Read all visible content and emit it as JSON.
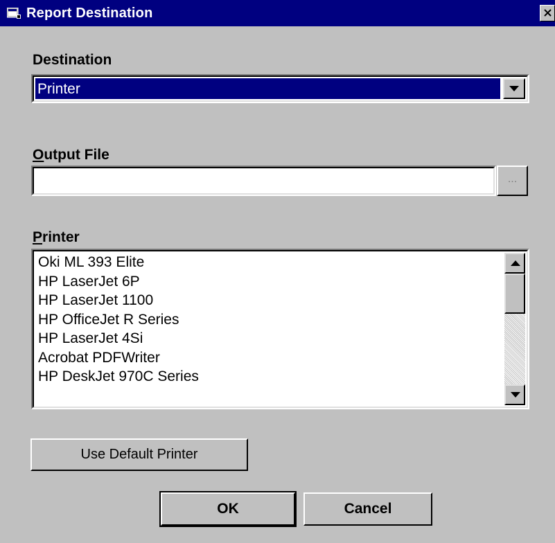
{
  "window": {
    "title": "Report Destination",
    "title_icon": "window-app-icon",
    "close_icon": "close-icon"
  },
  "destination": {
    "label": "Destination",
    "selected": "Printer",
    "dropdown_icon": "chevron-down-icon"
  },
  "output_file": {
    "label_accel": "O",
    "label_rest": "utput File",
    "value": "",
    "browse_label": "..."
  },
  "printer": {
    "label_accel": "P",
    "label_rest": "rinter",
    "items": [
      "Oki ML 393 Elite",
      "HP LaserJet 6P",
      "HP LaserJet 1100",
      "HP OfficeJet R Series",
      "HP LaserJet 4Si",
      "Acrobat PDFWriter",
      "HP DeskJet 970C Series"
    ]
  },
  "buttons": {
    "use_default": "Use Default Printer",
    "ok": "OK",
    "cancel": "Cancel"
  },
  "colors": {
    "titlebar": "#000080",
    "selection": "#000080",
    "face": "#c0c0c0"
  }
}
